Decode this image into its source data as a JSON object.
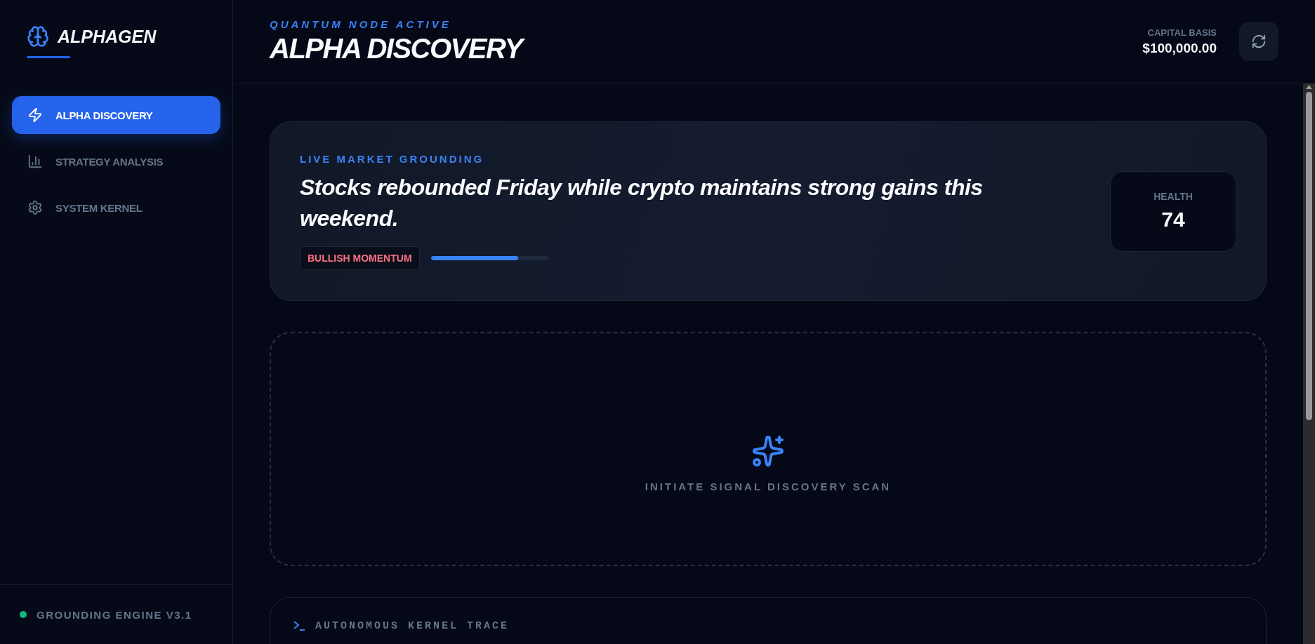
{
  "brand": {
    "name": "ALPHAGEN"
  },
  "sidebar": {
    "items": [
      {
        "label": "ALPHA DISCOVERY",
        "selected": true
      },
      {
        "label": "STRATEGY ANALYSIS",
        "selected": false
      },
      {
        "label": "SYSTEM KERNEL",
        "selected": false
      }
    ],
    "status": {
      "label": "GROUNDING ENGINE V3.1",
      "color": "#10b981"
    }
  },
  "header": {
    "eyebrow": "QUANTUM NODE ACTIVE",
    "title": "ALPHA DISCOVERY",
    "capital_label": "CAPITAL BASIS",
    "capital_value": "$100,000.00"
  },
  "market": {
    "eyebrow": "LIVE MARKET GROUNDING",
    "headline": "Stocks rebounded Friday while crypto maintains strong gains this weekend.",
    "sentiment": "BULLISH MOMENTUM",
    "level": 0.74,
    "health_label": "HEALTH",
    "health_value": "74"
  },
  "scan": {
    "label": "INITIATE SIGNAL DISCOVERY SCAN"
  },
  "trace": {
    "title": "AUTONOMOUS KERNEL TRACE"
  }
}
